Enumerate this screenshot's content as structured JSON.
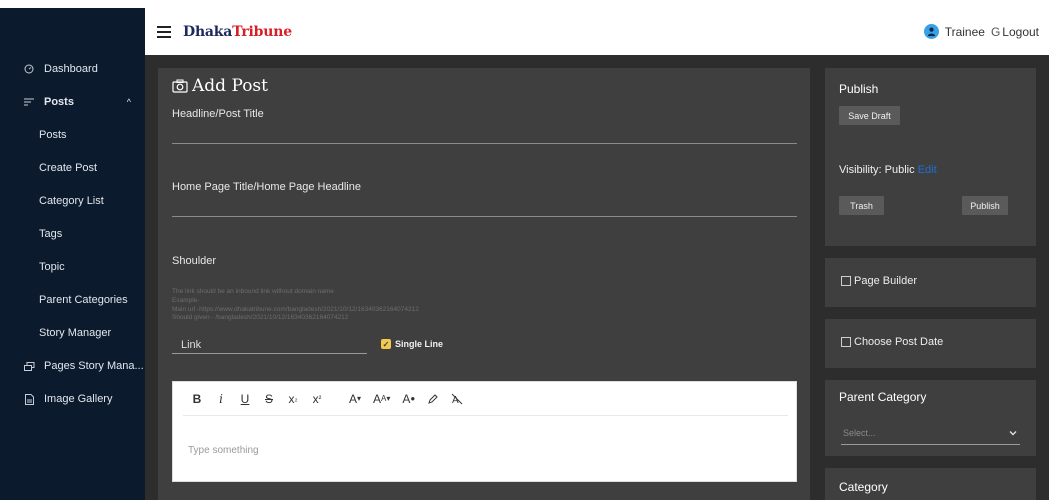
{
  "header": {
    "brand_part1": "Dhaka",
    "brand_part2": "Tribune",
    "user_label": "Trainee",
    "logout_label": "Logout"
  },
  "sidebar": {
    "dashboard": "Dashboard",
    "posts": "Posts",
    "sub_items": [
      "Posts",
      "Create Post",
      "Category List",
      "Tags",
      "Topic",
      "Parent Categories",
      "Story Manager"
    ],
    "pages_story": "Pages Story Mana...",
    "image_gallery": "Image Gallery"
  },
  "main": {
    "title": "Add Post",
    "headline_label": "Headline/Post Title",
    "home_headline_label": "Home Page Title/Home Page Headline",
    "shoulder_label": "Shoulder",
    "help_lines": [
      "The link should be an inbound link without domain name",
      "Example-",
      "Main url -https://www.dhakatribune.com/bangladesh/2021/10/12/16340362164074212",
      "Should given - /bangladesh/2021/10/12/16340362164074212"
    ],
    "link_label": "Link",
    "single_line_label": "Single Line",
    "editor_placeholder": "Type something"
  },
  "right": {
    "publish_title": "Publish",
    "save_draft": "Save Draft",
    "visibility_label": "Visibility: Public",
    "visibility_edit": "Edit",
    "trash": "Trash",
    "publish": "Publish",
    "page_builder": "Page Builder",
    "choose_post_date": "Choose Post Date",
    "parent_category_title": "Parent Category",
    "select_placeholder": "Select...",
    "category_title": "Category"
  }
}
